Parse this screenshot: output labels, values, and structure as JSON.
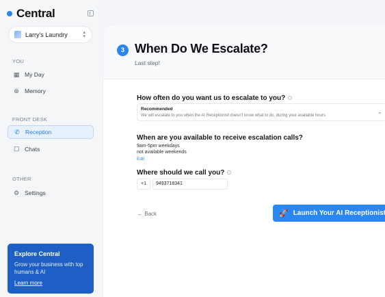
{
  "sidebar": {
    "brand": "Central",
    "workspace": "Larry's Laundry",
    "sections": {
      "you": "YOU",
      "front_desk": "FRONT DESK",
      "other": "OTHER"
    },
    "items": {
      "my_day": "My Day",
      "memory": "Memory",
      "reception": "Reception",
      "chats": "Chats",
      "settings": "Settings"
    },
    "promo": {
      "title": "Explore Central",
      "text": "Grow your business with top humans & AI",
      "link": "Learn more"
    }
  },
  "main": {
    "step": "3",
    "title": "When Do We Escalate?",
    "subtitle": "Last step!",
    "q1": {
      "label": "How often do you want us to escalate to you?",
      "selected_title": "Recommended",
      "selected_desc": "We will escalate to you when the AI Receptionist doesn't know what to do, during your available hours"
    },
    "q2": {
      "label": "When are you available to receive escalation calls?",
      "line1": "9am-5pm weekdays",
      "line2": "not available weekends",
      "edit": "Edit"
    },
    "q3": {
      "label": "Where should we call you?",
      "country_code": "+1",
      "phone": "9493718341"
    },
    "back": "Back",
    "launch": "Launch Your AI Receptionist"
  },
  "colors": {
    "accent": "#2a86f0",
    "promo_bg": "#1d5fc4",
    "active_bg": "#e6f1fd"
  }
}
